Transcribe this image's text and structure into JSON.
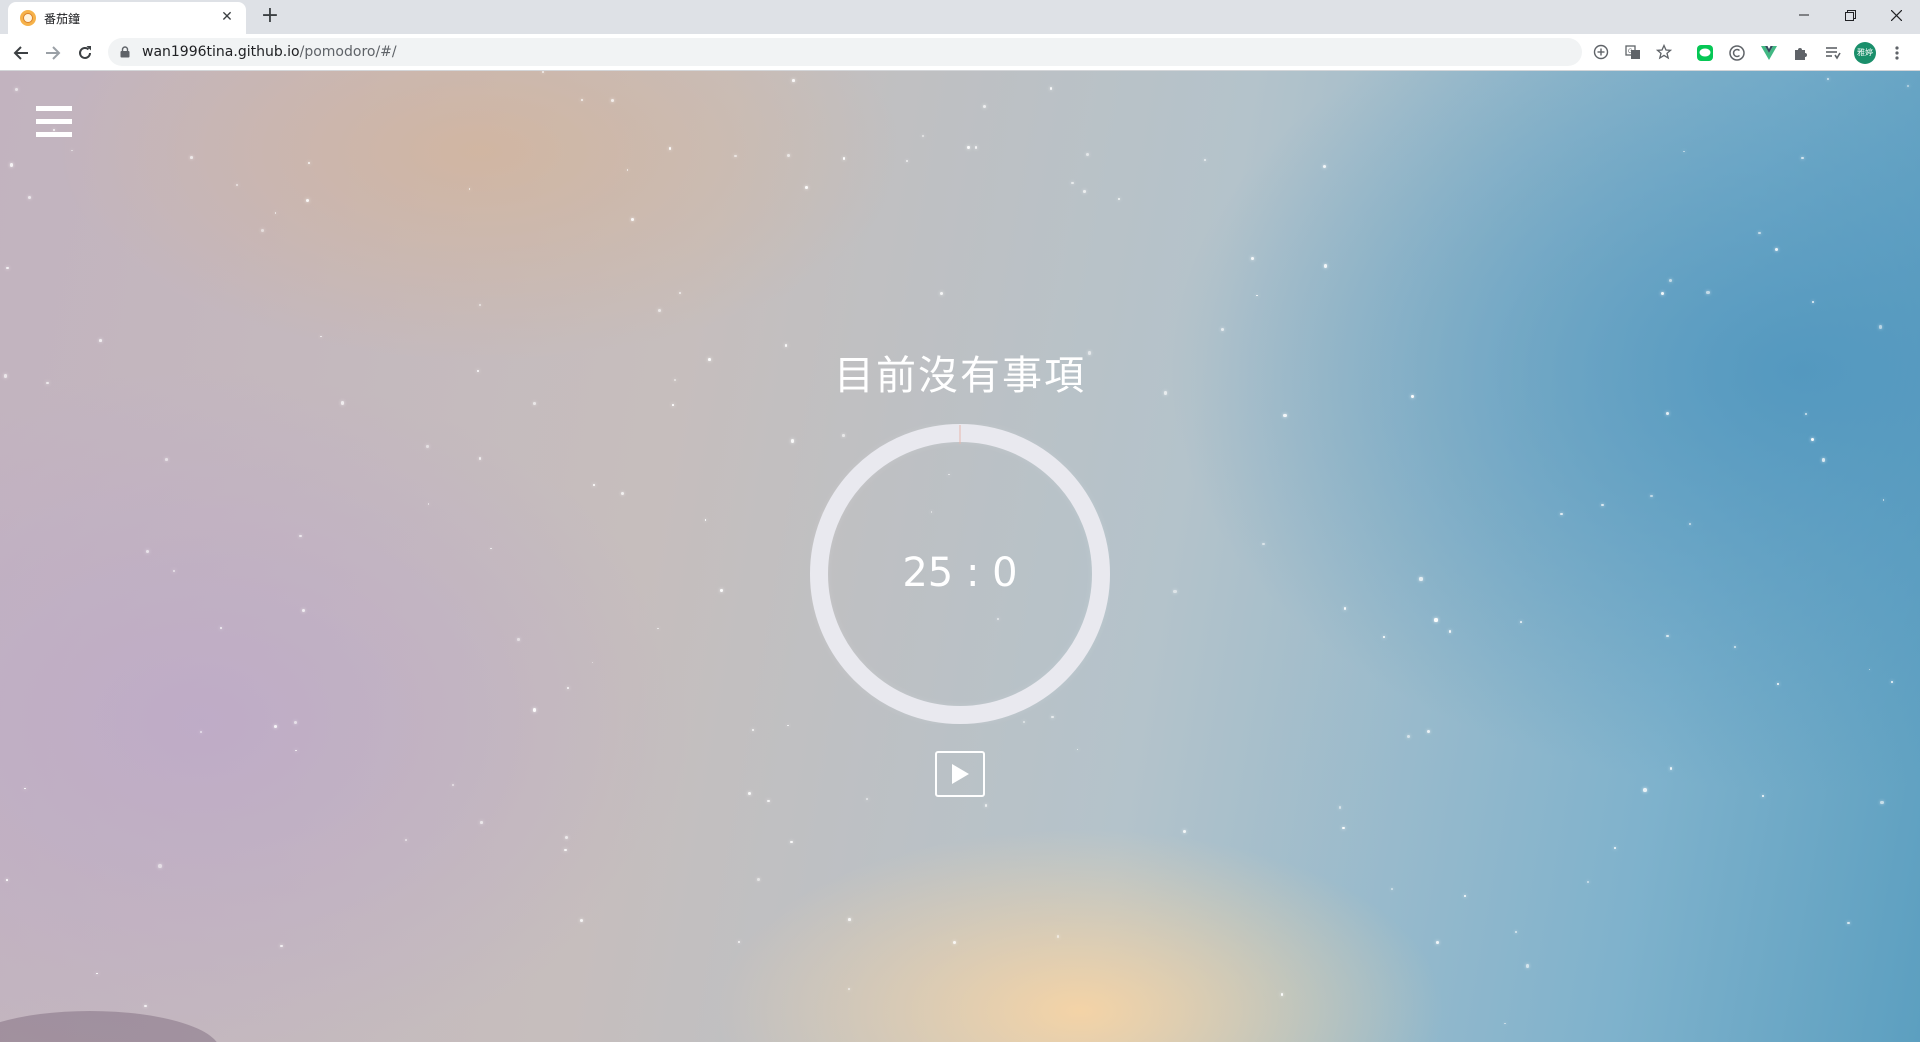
{
  "browser": {
    "tab": {
      "title": "番茄鐘",
      "close_label": "✕"
    },
    "new_tab_label": "+",
    "window_controls": {
      "minimize": "—",
      "restore": "❐",
      "close": "✕"
    },
    "address": {
      "host": "wan1996tina.github.io",
      "path": "/pomodoro/#/"
    },
    "profile_avatar_text": "雅婷",
    "icons": {
      "back": "back-arrow-icon",
      "forward": "forward-arrow-icon",
      "reload": "reload-icon",
      "lock": "lock-icon",
      "add_to_home": "plus-circle-icon",
      "translate": "translate-icon",
      "bookmark": "star-icon",
      "line_extension": "line-icon",
      "extension_2": "circle-c-icon",
      "vue_devtools": "vue-icon",
      "extensions": "puzzle-icon",
      "reading_list": "reading-list-icon",
      "more": "more-vert-icon"
    },
    "colors": {
      "line_green": "#06c755",
      "vue_green": "#41b883",
      "avatar_teal": "#1a8f6b"
    }
  },
  "app": {
    "menu_icon": "hamburger-icon",
    "current_task_title": "目前沒有事項",
    "timer": {
      "minutes": "25",
      "separator": ":",
      "seconds": "0",
      "display": "25 : 0",
      "progress": 0
    },
    "play_icon": "play-icon",
    "colors": {
      "ring": "#e9e9ef",
      "text": "#ffffff"
    }
  }
}
